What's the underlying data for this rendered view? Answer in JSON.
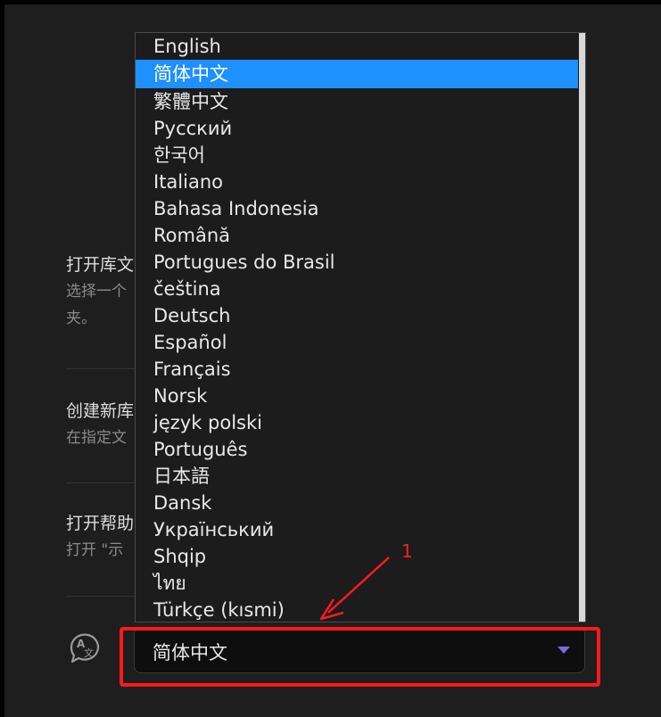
{
  "items": [
    {
      "title": "打开库文",
      "desc_line1": "选择一个",
      "desc_line2": "夹。"
    },
    {
      "title": "创建新库",
      "desc_line1": "在指定文",
      "desc_line2": ""
    },
    {
      "title": "打开帮助",
      "desc_line1": "打开 \"示",
      "desc_line2": ""
    }
  ],
  "language_select": {
    "value": "简体中文",
    "options": [
      "English",
      "简体中文",
      "繁體中文",
      "Русский",
      "한국어",
      "Italiano",
      "Bahasa Indonesia",
      "Română",
      "Portugues do Brasil",
      "čeština",
      "Deutsch",
      "Español",
      "Français",
      "Norsk",
      "język polski",
      "Português",
      "日本語",
      "Dansk",
      "Український",
      "Shqip",
      "ไทย",
      "Türkçe (kısmi)"
    ],
    "selected_index": 1
  },
  "annotation": {
    "number": "1",
    "color": "#ff1a1a"
  },
  "icons": {
    "language": "translate-icon",
    "caret": "caret-down-icon"
  }
}
